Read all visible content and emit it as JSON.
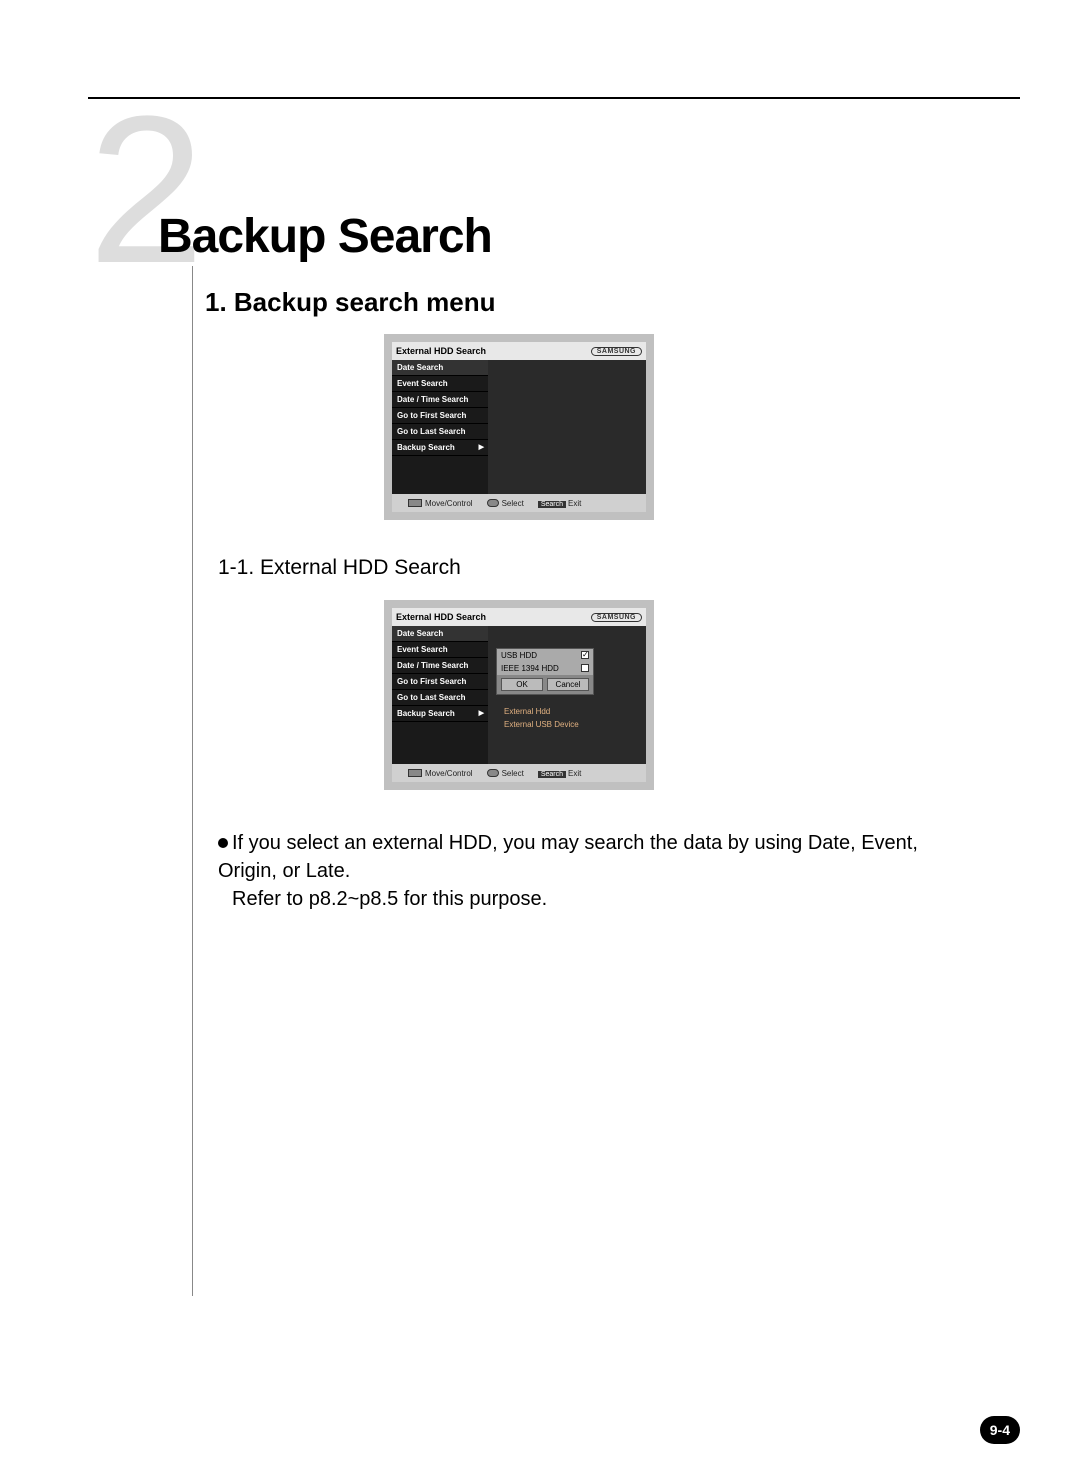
{
  "chapter": {
    "number": "2",
    "title": "Backup Search"
  },
  "section": {
    "heading": "1. Backup search menu"
  },
  "subsection": {
    "heading": "1-1. External HDD Search"
  },
  "body": {
    "p1": "If you select an external HDD, you may search the data by using Date, Event, Origin, or Late.",
    "p2": "Refer to p8.2~p8.5 for this purpose."
  },
  "dvr": {
    "header_title": "External HDD Search",
    "logo": "SAMSUNG",
    "menu": {
      "date": "Date  Search",
      "event": "Event Search",
      "datetime": "Date / Time Search",
      "first": "Go to First Search",
      "last": "Go to Last Search",
      "backup": "Backup  Search"
    },
    "popup": {
      "usb": "USB HDD",
      "ieee": "IEEE 1394 HDD",
      "ok": "OK",
      "cancel": "Cancel"
    },
    "submenu": {
      "ext_hdd": "External Hdd",
      "ext_usb": "External USB Device"
    },
    "footer": {
      "move": "Move/Control",
      "select": "Select",
      "search": "Search",
      "exit": "Exit"
    }
  },
  "page_number": "9-4"
}
